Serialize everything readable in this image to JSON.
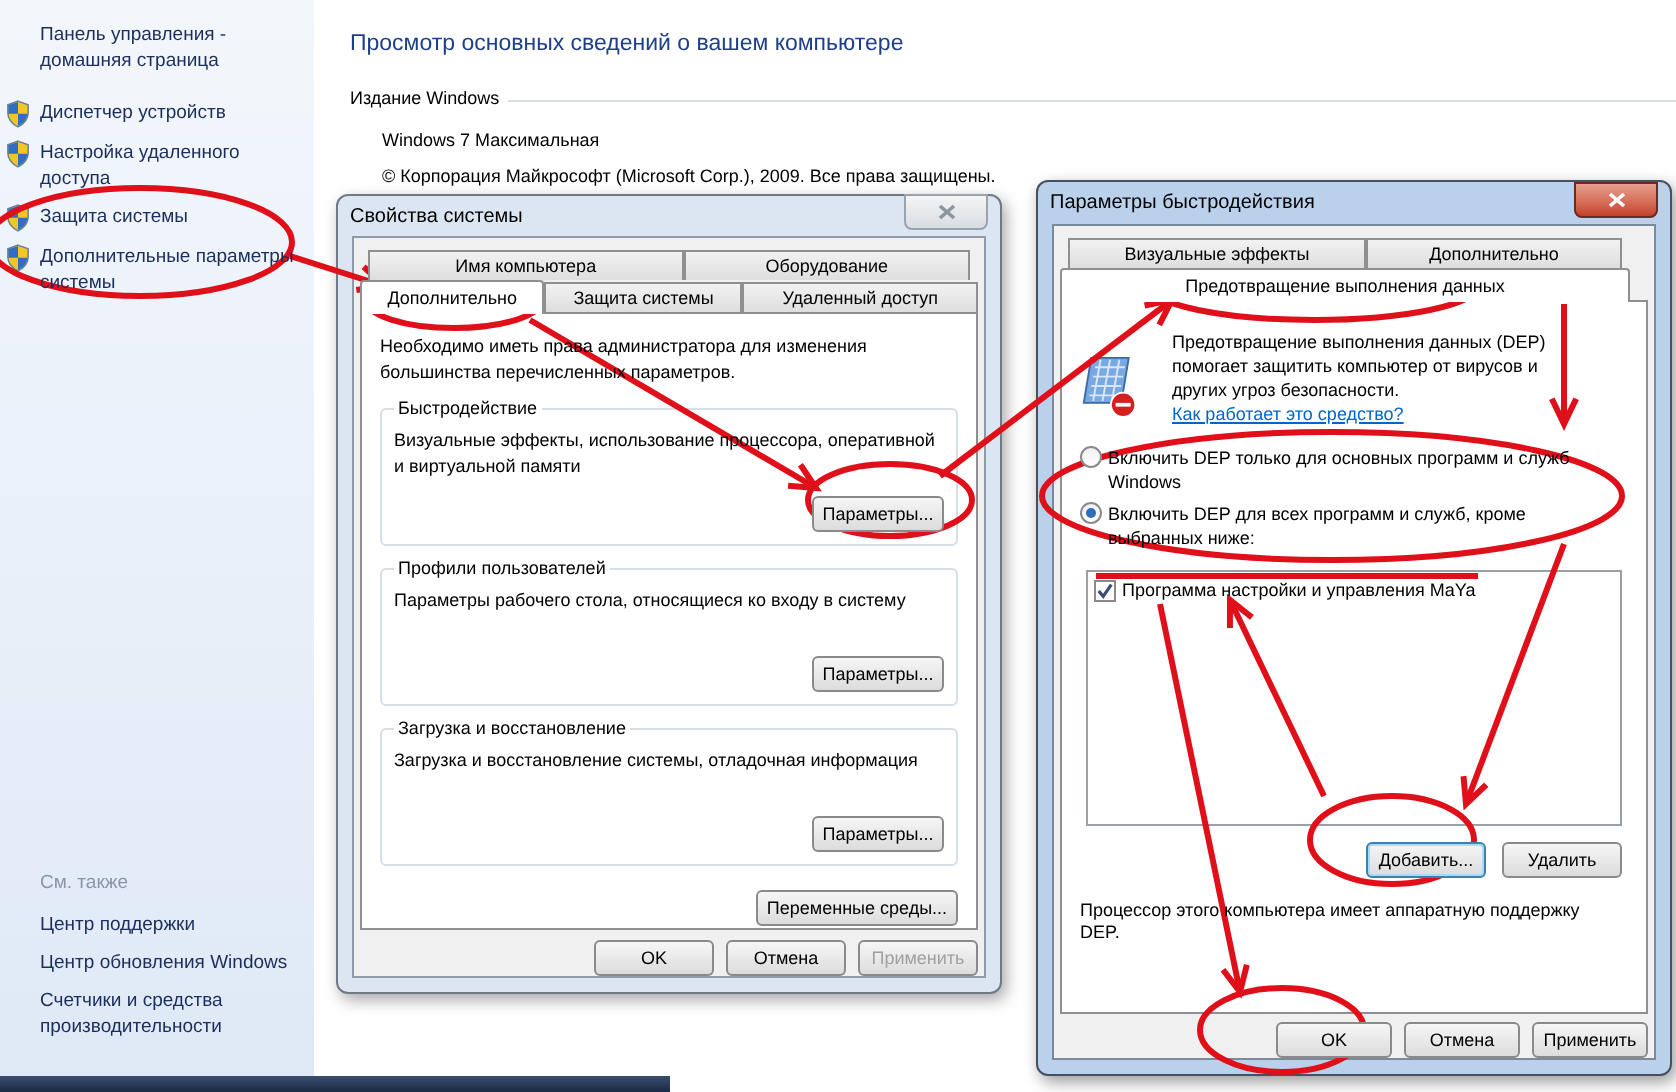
{
  "control_panel": {
    "sidebar": {
      "home_link": "Панель управления - домашняя страница",
      "tasks": [
        {
          "label": "Диспетчер устройств"
        },
        {
          "label": "Настройка удаленного доступа"
        },
        {
          "label": "Защита системы"
        },
        {
          "label": "Дополнительные параметры системы"
        }
      ],
      "see_also_heading": "См. также",
      "see_also": [
        "Центр поддержки",
        "Центр обновления Windows",
        "Счетчики и средства производительности"
      ]
    },
    "main": {
      "title": "Просмотр основных сведений о вашем компьютере",
      "section": "Издание Windows",
      "edition": "Windows 7 Максимальная",
      "copyright": "© Корпорация Майкрософт (Microsoft Corp.), 2009. Все права защищены."
    }
  },
  "system_properties": {
    "title": "Свойства системы",
    "tab_rows": [
      [
        {
          "label": "Имя компьютера",
          "selected": false
        },
        {
          "label": "Оборудование",
          "selected": false
        }
      ],
      [
        {
          "label": "Дополнительно",
          "selected": true
        },
        {
          "label": "Защита системы",
          "selected": false
        },
        {
          "label": "Удаленный доступ",
          "selected": false
        }
      ]
    ],
    "note": "Необходимо иметь права администратора для изменения большинства перечисленных параметров.",
    "groups": [
      {
        "legend": "Быстродействие",
        "description": "Визуальные эффекты, использование процессора, оперативной и виртуальной памяти",
        "button": "Параметры..."
      },
      {
        "legend": "Профили пользователей",
        "description": "Параметры рабочего стола, относящиеся ко входу в систему",
        "button": "Параметры..."
      },
      {
        "legend": "Загрузка и восстановление",
        "description": "Загрузка и восстановление системы, отладочная информация",
        "button": "Параметры..."
      }
    ],
    "env_button": "Переменные среды...",
    "buttons": [
      {
        "label": "OK",
        "disabled": false
      },
      {
        "label": "Отмена",
        "disabled": false
      },
      {
        "label": "Применить",
        "disabled": true
      }
    ]
  },
  "performance_options": {
    "title": "Параметры быстродействия",
    "tab_rows": [
      [
        {
          "label": "Визуальные эффекты",
          "selected": false
        },
        {
          "label": "Дополнительно",
          "selected": false
        }
      ],
      [
        {
          "label": "Предотвращение выполнения данных",
          "selected": true
        }
      ]
    ],
    "intro": "Предотвращение выполнения данных (DEP) помогает защитить компьютер от вирусов и других угроз безопасности.",
    "link": "Как работает это средство?",
    "options": [
      {
        "label": "Включить DEP только для основных программ и служб Windows",
        "selected": false
      },
      {
        "label": "Включить DEP для всех программ и служб, кроме выбранных ниже:",
        "selected": true
      }
    ],
    "programs": [
      {
        "label": "Программа настройки и управления MaYa",
        "checked": true
      }
    ],
    "list_buttons": [
      {
        "label": "Добавить...",
        "focused": true
      },
      {
        "label": "Удалить",
        "focused": false
      }
    ],
    "processor_note": "Процессор этого компьютера имеет аппаратную поддержку DEP.",
    "buttons": [
      {
        "label": "OK",
        "disabled": false
      },
      {
        "label": "Отмена",
        "disabled": false
      },
      {
        "label": "Применить",
        "disabled": false
      }
    ]
  }
}
